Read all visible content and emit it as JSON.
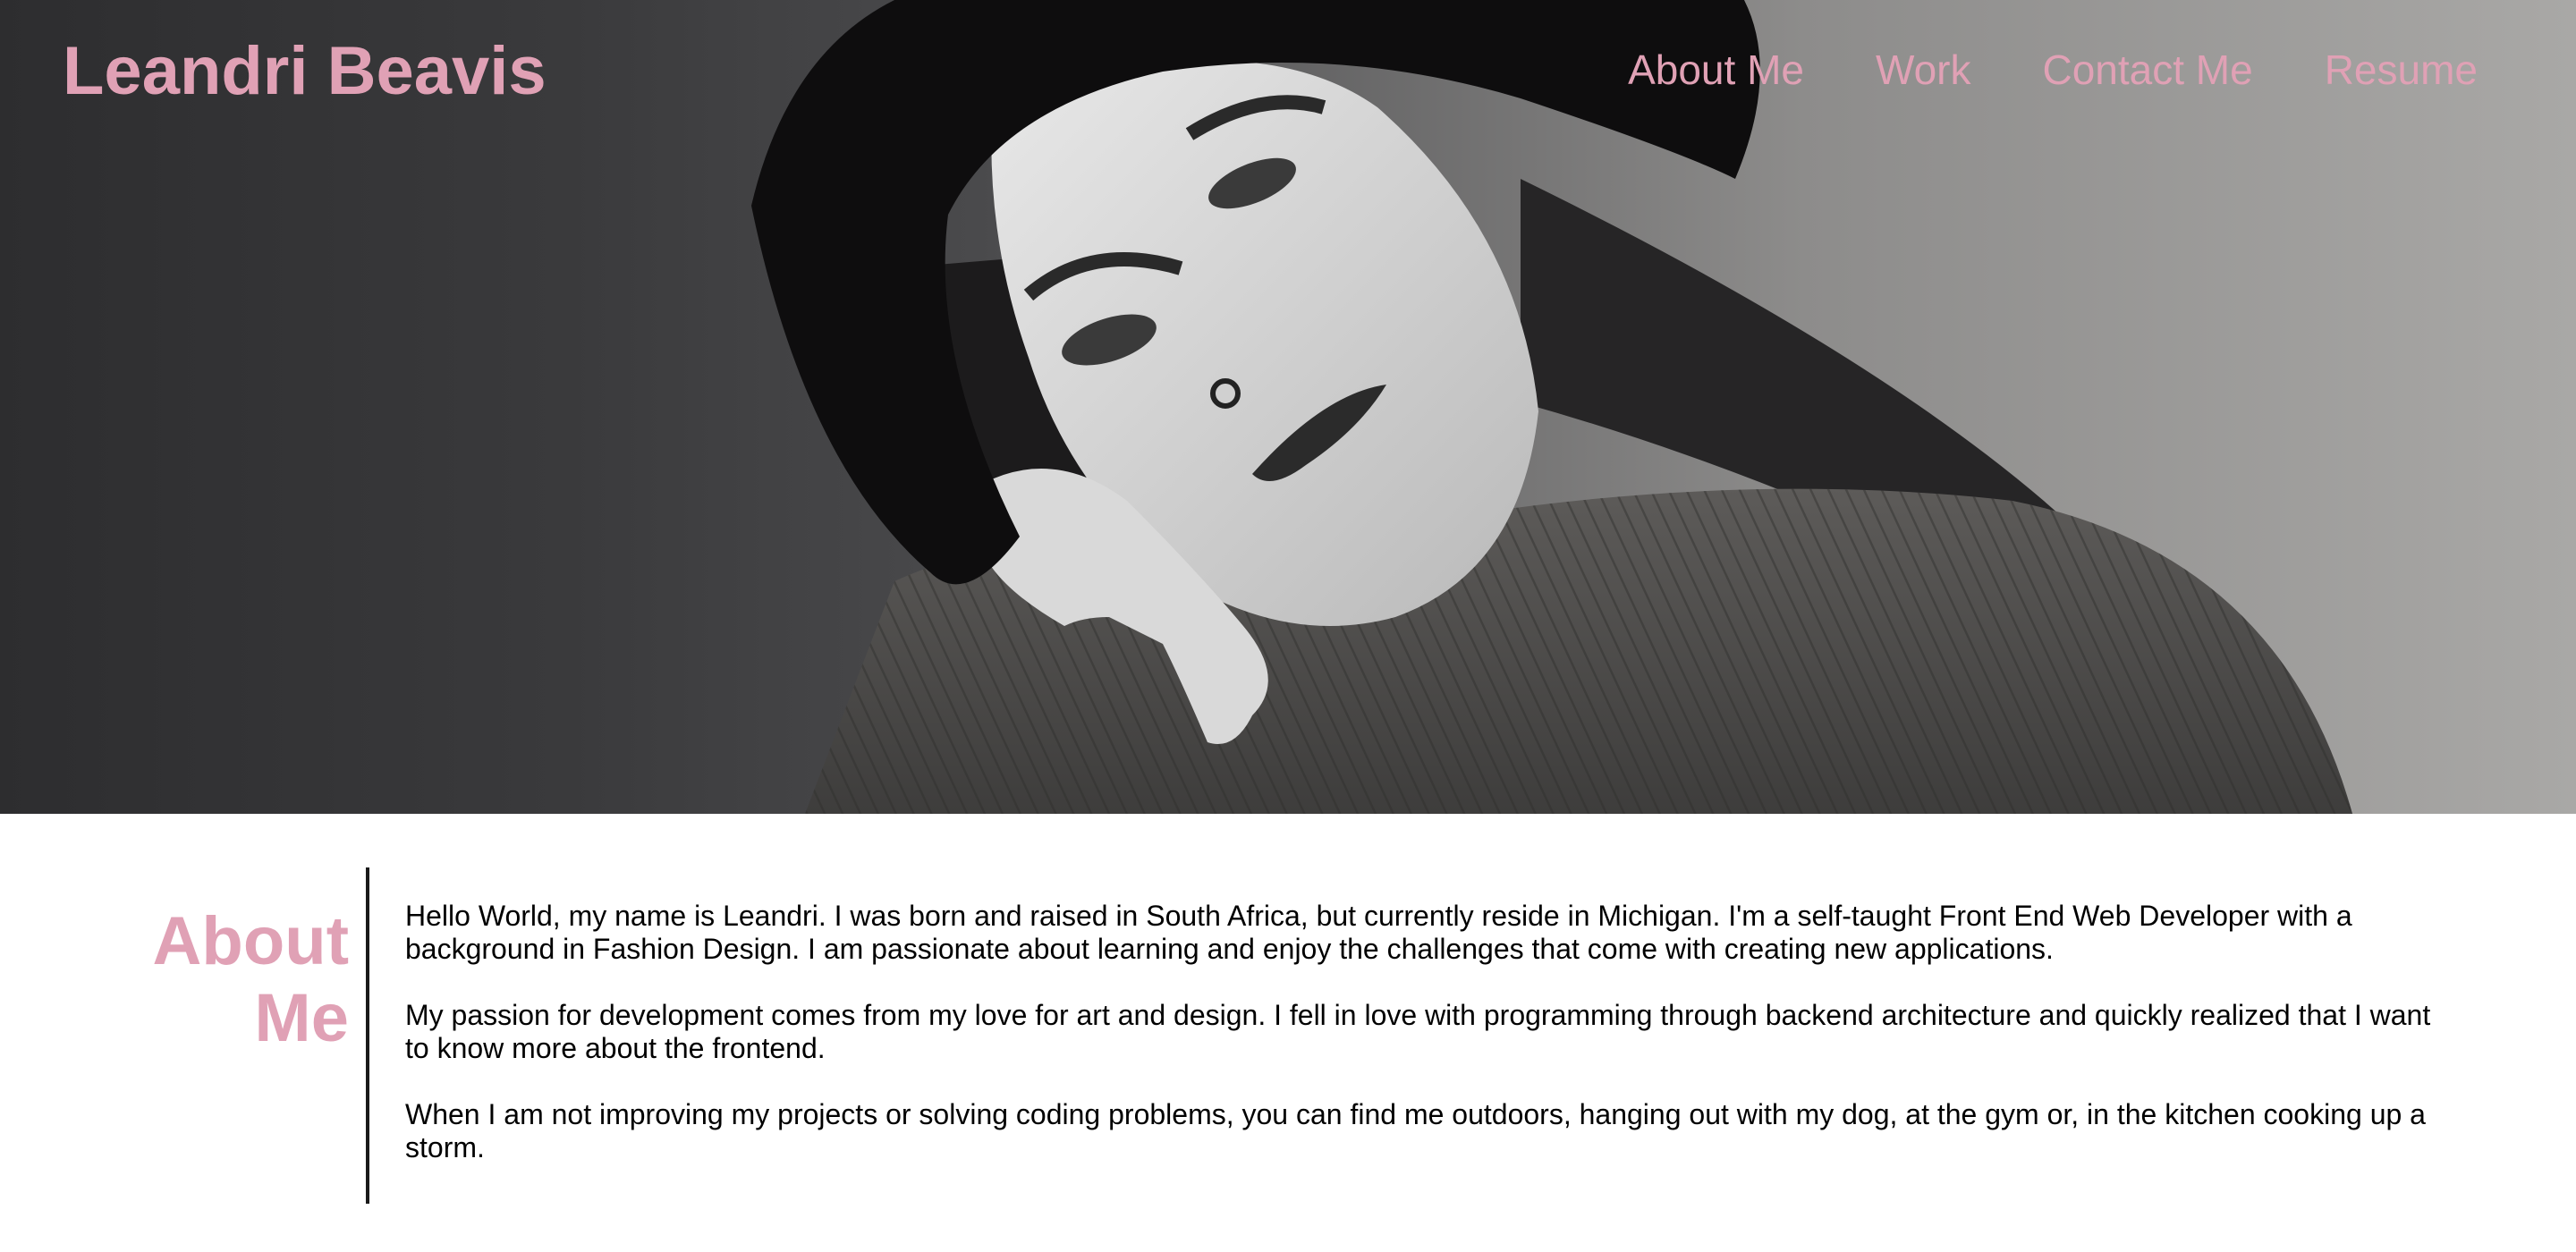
{
  "header": {
    "site_title": "Leandri Beavis",
    "nav": [
      "About Me",
      "Work",
      "Contact Me",
      "Resume"
    ]
  },
  "about": {
    "heading": "About Me",
    "paragraphs": [
      "Hello World, my name is Leandri. I was born and raised in South Africa, but currently reside in Michigan. I'm a self-taught Front End Web Developer with a background in Fashion Design. I am passionate about learning and enjoy the challenges that come with creating new applications.",
      "My passion for development comes from my love for art and design. I fell in love with programming through backend architecture and quickly realized that I want to know more about the frontend.",
      "When I am not improving my projects or solving coding problems, you can find me outdoors, hanging out with my dog, at the gym or, in the kitchen cooking up a storm."
    ]
  },
  "colors": {
    "accent": "#e0a1b5",
    "text": "#000000",
    "divider": "#1a1a1a"
  }
}
